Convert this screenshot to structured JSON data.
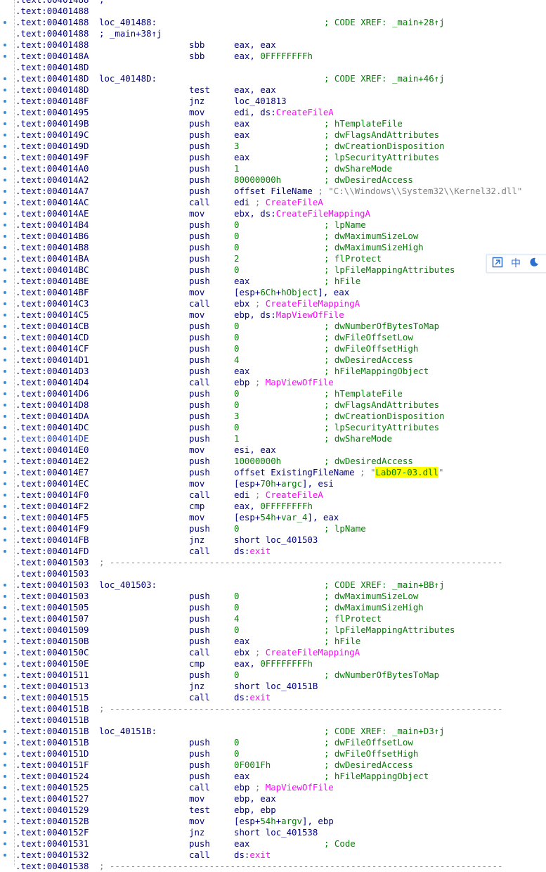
{
  "listing": [
    {
      "addr": ".text:00401488",
      "comment": ";"
    },
    {
      "addr": ".text:00401488"
    },
    {
      "addr": ".text:00401488",
      "label": "loc_401488:",
      "comment": "; CODE XREF: _main+28↑j"
    },
    {
      "addr": ".text:00401488",
      "comment": "; _main+38↑j"
    },
    {
      "addr": ".text:00401488",
      "mn": "sbb",
      "op": [
        {
          "t": "eax, eax",
          "c": "reg"
        }
      ]
    },
    {
      "addr": ".text:0040148A",
      "mn": "sbb",
      "op": [
        {
          "t": "eax, ",
          "c": "reg"
        },
        {
          "t": "0FFFFFFFFh",
          "c": "num"
        }
      ]
    },
    {
      "addr": ".text:0040148D"
    },
    {
      "addr": ".text:0040148D",
      "label": "loc_40148D:",
      "comment": "; CODE XREF: _main+46↑j"
    },
    {
      "addr": ".text:0040148D",
      "mn": "test",
      "op": [
        {
          "t": "eax, eax",
          "c": "reg"
        }
      ]
    },
    {
      "addr": ".text:0040148F",
      "mn": "jnz",
      "op": [
        {
          "t": "loc_401813",
          "c": "reg"
        }
      ]
    },
    {
      "addr": ".text:00401495",
      "mn": "mov",
      "op": [
        {
          "t": "edi, ds:",
          "c": "reg"
        },
        {
          "t": "CreateFileA",
          "c": "api"
        }
      ]
    },
    {
      "addr": ".text:0040149B",
      "mn": "push",
      "op": [
        {
          "t": "eax",
          "c": "reg"
        }
      ],
      "comment": "; hTemplateFile"
    },
    {
      "addr": ".text:0040149C",
      "mn": "push",
      "op": [
        {
          "t": "eax",
          "c": "reg"
        }
      ],
      "comment": "; dwFlagsAndAttributes"
    },
    {
      "addr": ".text:0040149D",
      "mn": "push",
      "op": [
        {
          "t": "3",
          "c": "num"
        }
      ],
      "comment": "; dwCreationDisposition"
    },
    {
      "addr": ".text:0040149F",
      "mn": "push",
      "op": [
        {
          "t": "eax",
          "c": "reg"
        }
      ],
      "comment": "; lpSecurityAttributes"
    },
    {
      "addr": ".text:004014A0",
      "mn": "push",
      "op": [
        {
          "t": "1",
          "c": "num"
        }
      ],
      "comment": "; dwShareMode"
    },
    {
      "addr": ".text:004014A2",
      "mn": "push",
      "op": [
        {
          "t": "80000000h",
          "c": "num"
        }
      ],
      "comment": "; dwDesiredAccess"
    },
    {
      "addr": ".text:004014A7",
      "mn": "push",
      "op": [
        {
          "t": "offset FileName ",
          "c": "reg"
        },
        {
          "t": "; \"C:\\\\Windows\\\\System32\\\\Kernel32.dll\"",
          "c": "str"
        }
      ]
    },
    {
      "addr": ".text:004014AC",
      "mn": "call",
      "op": [
        {
          "t": "edi ",
          "c": "reg"
        },
        {
          "t": "; ",
          "c": "str"
        },
        {
          "t": "CreateFileA",
          "c": "api"
        }
      ]
    },
    {
      "addr": ".text:004014AE",
      "mn": "mov",
      "op": [
        {
          "t": "ebx, ds:",
          "c": "reg"
        },
        {
          "t": "CreateFileMappingA",
          "c": "api"
        }
      ]
    },
    {
      "addr": ".text:004014B4",
      "mn": "push",
      "op": [
        {
          "t": "0",
          "c": "num"
        }
      ],
      "comment": "; lpName"
    },
    {
      "addr": ".text:004014B6",
      "mn": "push",
      "op": [
        {
          "t": "0",
          "c": "num"
        }
      ],
      "comment": "; dwMaximumSizeLow"
    },
    {
      "addr": ".text:004014B8",
      "mn": "push",
      "op": [
        {
          "t": "0",
          "c": "num"
        }
      ],
      "comment": "; dwMaximumSizeHigh"
    },
    {
      "addr": ".text:004014BA",
      "mn": "push",
      "op": [
        {
          "t": "2",
          "c": "num"
        }
      ],
      "comment": "; flProtect"
    },
    {
      "addr": ".text:004014BC",
      "mn": "push",
      "op": [
        {
          "t": "0",
          "c": "num"
        }
      ],
      "comment": "; lpFileMappingAttributes"
    },
    {
      "addr": ".text:004014BE",
      "mn": "push",
      "op": [
        {
          "t": "eax",
          "c": "reg"
        }
      ],
      "comment": "; hFile"
    },
    {
      "addr": ".text:004014BF",
      "mn": "mov",
      "op": [
        {
          "t": "[esp+",
          "c": "reg"
        },
        {
          "t": "6Ch",
          "c": "num"
        },
        {
          "t": "+",
          "c": "reg"
        },
        {
          "t": "hObject",
          "c": "num"
        },
        {
          "t": "], eax",
          "c": "reg"
        }
      ]
    },
    {
      "addr": ".text:004014C3",
      "mn": "call",
      "op": [
        {
          "t": "ebx ",
          "c": "reg"
        },
        {
          "t": "; ",
          "c": "str"
        },
        {
          "t": "CreateFileMappingA",
          "c": "api"
        }
      ]
    },
    {
      "addr": ".text:004014C5",
      "mn": "mov",
      "op": [
        {
          "t": "ebp, ds:",
          "c": "reg"
        },
        {
          "t": "MapViewOfFile",
          "c": "api"
        }
      ]
    },
    {
      "addr": ".text:004014CB",
      "mn": "push",
      "op": [
        {
          "t": "0",
          "c": "num"
        }
      ],
      "comment": "; dwNumberOfBytesToMap"
    },
    {
      "addr": ".text:004014CD",
      "mn": "push",
      "op": [
        {
          "t": "0",
          "c": "num"
        }
      ],
      "comment": "; dwFileOffsetLow"
    },
    {
      "addr": ".text:004014CF",
      "mn": "push",
      "op": [
        {
          "t": "0",
          "c": "num"
        }
      ],
      "comment": "; dwFileOffsetHigh"
    },
    {
      "addr": ".text:004014D1",
      "mn": "push",
      "op": [
        {
          "t": "4",
          "c": "num"
        }
      ],
      "comment": "; dwDesiredAccess"
    },
    {
      "addr": ".text:004014D3",
      "mn": "push",
      "op": [
        {
          "t": "eax",
          "c": "reg"
        }
      ],
      "comment": "; hFileMappingObject"
    },
    {
      "addr": ".text:004014D4",
      "mn": "call",
      "op": [
        {
          "t": "ebp ",
          "c": "reg"
        },
        {
          "t": "; ",
          "c": "str"
        },
        {
          "t": "MapViewOfFile",
          "c": "api"
        }
      ]
    },
    {
      "addr": ".text:004014D6",
      "mn": "push",
      "op": [
        {
          "t": "0",
          "c": "num"
        }
      ],
      "comment": "; hTemplateFile"
    },
    {
      "addr": ".text:004014D8",
      "mn": "push",
      "op": [
        {
          "t": "0",
          "c": "num"
        }
      ],
      "comment": "; dwFlagsAndAttributes"
    },
    {
      "addr": ".text:004014DA",
      "mn": "push",
      "op": [
        {
          "t": "3",
          "c": "num"
        }
      ],
      "comment": "; dwCreationDisposition"
    },
    {
      "addr": ".text:004014DC",
      "mn": "push",
      "op": [
        {
          "t": "0",
          "c": "num"
        }
      ],
      "comment": "; lpSecurityAttributes"
    },
    {
      "addr": ".text:004014DE",
      "mn": "push",
      "op": [
        {
          "t": "1",
          "c": "num"
        }
      ],
      "comment": "; dwShareMode",
      "alt": true
    },
    {
      "addr": ".text:004014E0",
      "mn": "mov",
      "op": [
        {
          "t": "esi, eax",
          "c": "reg"
        }
      ]
    },
    {
      "addr": ".text:004014E2",
      "mn": "push",
      "op": [
        {
          "t": "10000000h",
          "c": "num"
        }
      ],
      "comment": "; dwDesiredAccess"
    },
    {
      "addr": ".text:004014E7",
      "mn": "push",
      "op": [
        {
          "t": "offset ExistingFileName ",
          "c": "reg"
        },
        {
          "t": "; \"",
          "c": "str"
        },
        {
          "t": "Lab07-03.dll",
          "c": "hl"
        },
        {
          "t": "\"",
          "c": "str"
        }
      ]
    },
    {
      "addr": ".text:004014EC",
      "mn": "mov",
      "op": [
        {
          "t": "[esp+",
          "c": "reg"
        },
        {
          "t": "70h",
          "c": "num"
        },
        {
          "t": "+",
          "c": "reg"
        },
        {
          "t": "argc",
          "c": "num"
        },
        {
          "t": "], esi",
          "c": "reg"
        }
      ]
    },
    {
      "addr": ".text:004014F0",
      "mn": "call",
      "op": [
        {
          "t": "edi ",
          "c": "reg"
        },
        {
          "t": "; ",
          "c": "str"
        },
        {
          "t": "CreateFileA",
          "c": "api"
        }
      ]
    },
    {
      "addr": ".text:004014F2",
      "mn": "cmp",
      "op": [
        {
          "t": "eax, ",
          "c": "reg"
        },
        {
          "t": "0FFFFFFFFh",
          "c": "num"
        }
      ]
    },
    {
      "addr": ".text:004014F5",
      "mn": "mov",
      "op": [
        {
          "t": "[esp+",
          "c": "reg"
        },
        {
          "t": "54h",
          "c": "num"
        },
        {
          "t": "+",
          "c": "reg"
        },
        {
          "t": "var_4",
          "c": "num"
        },
        {
          "t": "], eax",
          "c": "reg"
        }
      ]
    },
    {
      "addr": ".text:004014F9",
      "mn": "push",
      "op": [
        {
          "t": "0",
          "c": "num"
        }
      ],
      "comment": "; lpName"
    },
    {
      "addr": ".text:004014FB",
      "mn": "jnz",
      "op": [
        {
          "t": "short loc_401503",
          "c": "reg"
        }
      ]
    },
    {
      "addr": ".text:004014FD",
      "mn": "call",
      "op": [
        {
          "t": "ds:",
          "c": "reg"
        },
        {
          "t": "exit",
          "c": "api"
        }
      ]
    },
    {
      "addr": ".text:00401503",
      "sep": "; ---------------------------------------------------------------------------"
    },
    {
      "addr": ".text:00401503"
    },
    {
      "addr": ".text:00401503",
      "label": "loc_401503:",
      "comment": "; CODE XREF: _main+BB↑j"
    },
    {
      "addr": ".text:00401503",
      "mn": "push",
      "op": [
        {
          "t": "0",
          "c": "num"
        }
      ],
      "comment": "; dwMaximumSizeLow"
    },
    {
      "addr": ".text:00401505",
      "mn": "push",
      "op": [
        {
          "t": "0",
          "c": "num"
        }
      ],
      "comment": "; dwMaximumSizeHigh"
    },
    {
      "addr": ".text:00401507",
      "mn": "push",
      "op": [
        {
          "t": "4",
          "c": "num"
        }
      ],
      "comment": "; flProtect"
    },
    {
      "addr": ".text:00401509",
      "mn": "push",
      "op": [
        {
          "t": "0",
          "c": "num"
        }
      ],
      "comment": "; lpFileMappingAttributes"
    },
    {
      "addr": ".text:0040150B",
      "mn": "push",
      "op": [
        {
          "t": "eax",
          "c": "reg"
        }
      ],
      "comment": "; hFile"
    },
    {
      "addr": ".text:0040150C",
      "mn": "call",
      "op": [
        {
          "t": "ebx ",
          "c": "reg"
        },
        {
          "t": "; ",
          "c": "str"
        },
        {
          "t": "CreateFileMappingA",
          "c": "api"
        }
      ]
    },
    {
      "addr": ".text:0040150E",
      "mn": "cmp",
      "op": [
        {
          "t": "eax, ",
          "c": "reg"
        },
        {
          "t": "0FFFFFFFFh",
          "c": "num"
        }
      ]
    },
    {
      "addr": ".text:00401511",
      "mn": "push",
      "op": [
        {
          "t": "0",
          "c": "num"
        }
      ],
      "comment": "; dwNumberOfBytesToMap"
    },
    {
      "addr": ".text:00401513",
      "mn": "jnz",
      "op": [
        {
          "t": "short loc_40151B",
          "c": "reg"
        }
      ]
    },
    {
      "addr": ".text:00401515",
      "mn": "call",
      "op": [
        {
          "t": "ds:",
          "c": "reg"
        },
        {
          "t": "exit",
          "c": "api"
        }
      ]
    },
    {
      "addr": ".text:0040151B",
      "sep": "; ---------------------------------------------------------------------------"
    },
    {
      "addr": ".text:0040151B"
    },
    {
      "addr": ".text:0040151B",
      "label": "loc_40151B:",
      "comment": "; CODE XREF: _main+D3↑j"
    },
    {
      "addr": ".text:0040151B",
      "mn": "push",
      "op": [
        {
          "t": "0",
          "c": "num"
        }
      ],
      "comment": "; dwFileOffsetLow"
    },
    {
      "addr": ".text:0040151D",
      "mn": "push",
      "op": [
        {
          "t": "0",
          "c": "num"
        }
      ],
      "comment": "; dwFileOffsetHigh"
    },
    {
      "addr": ".text:0040151F",
      "mn": "push",
      "op": [
        {
          "t": "0F001Fh",
          "c": "num"
        }
      ],
      "comment": "; dwDesiredAccess"
    },
    {
      "addr": ".text:00401524",
      "mn": "push",
      "op": [
        {
          "t": "eax",
          "c": "reg"
        }
      ],
      "comment": "; hFileMappingObject"
    },
    {
      "addr": ".text:00401525",
      "mn": "call",
      "op": [
        {
          "t": "ebp ",
          "c": "reg"
        },
        {
          "t": "; ",
          "c": "str"
        },
        {
          "t": "MapViewOfFile",
          "c": "api"
        }
      ]
    },
    {
      "addr": ".text:00401527",
      "mn": "mov",
      "op": [
        {
          "t": "ebp, eax",
          "c": "reg"
        }
      ]
    },
    {
      "addr": ".text:00401529",
      "mn": "test",
      "op": [
        {
          "t": "ebp, ebp",
          "c": "reg"
        }
      ]
    },
    {
      "addr": ".text:0040152B",
      "mn": "mov",
      "op": [
        {
          "t": "[esp+",
          "c": "reg"
        },
        {
          "t": "54h",
          "c": "num"
        },
        {
          "t": "+",
          "c": "reg"
        },
        {
          "t": "argv",
          "c": "num"
        },
        {
          "t": "], ebp",
          "c": "reg"
        }
      ]
    },
    {
      "addr": ".text:0040152F",
      "mn": "jnz",
      "op": [
        {
          "t": "short loc_401538",
          "c": "reg"
        }
      ]
    },
    {
      "addr": ".text:00401531",
      "mn": "push",
      "op": [
        {
          "t": "eax",
          "c": "reg"
        }
      ],
      "comment": "; Code"
    },
    {
      "addr": ".text:00401532",
      "mn": "call",
      "op": [
        {
          "t": "ds:",
          "c": "reg"
        },
        {
          "t": "exit",
          "c": "api"
        }
      ]
    },
    {
      "addr": ".text:00401538",
      "sep": "; ---------------------------------------------------------------------------"
    }
  ],
  "ime_toolbar": {
    "mode_icon": "switch-icon",
    "lang": "中",
    "theme_icon": "moon-icon"
  },
  "colors": {
    "address": "#000080",
    "comment": "#008000",
    "api": "#ff00ff",
    "string": "#808080",
    "highlight": "#ffff00",
    "breakpoint_dot": "#3a8ad8"
  }
}
